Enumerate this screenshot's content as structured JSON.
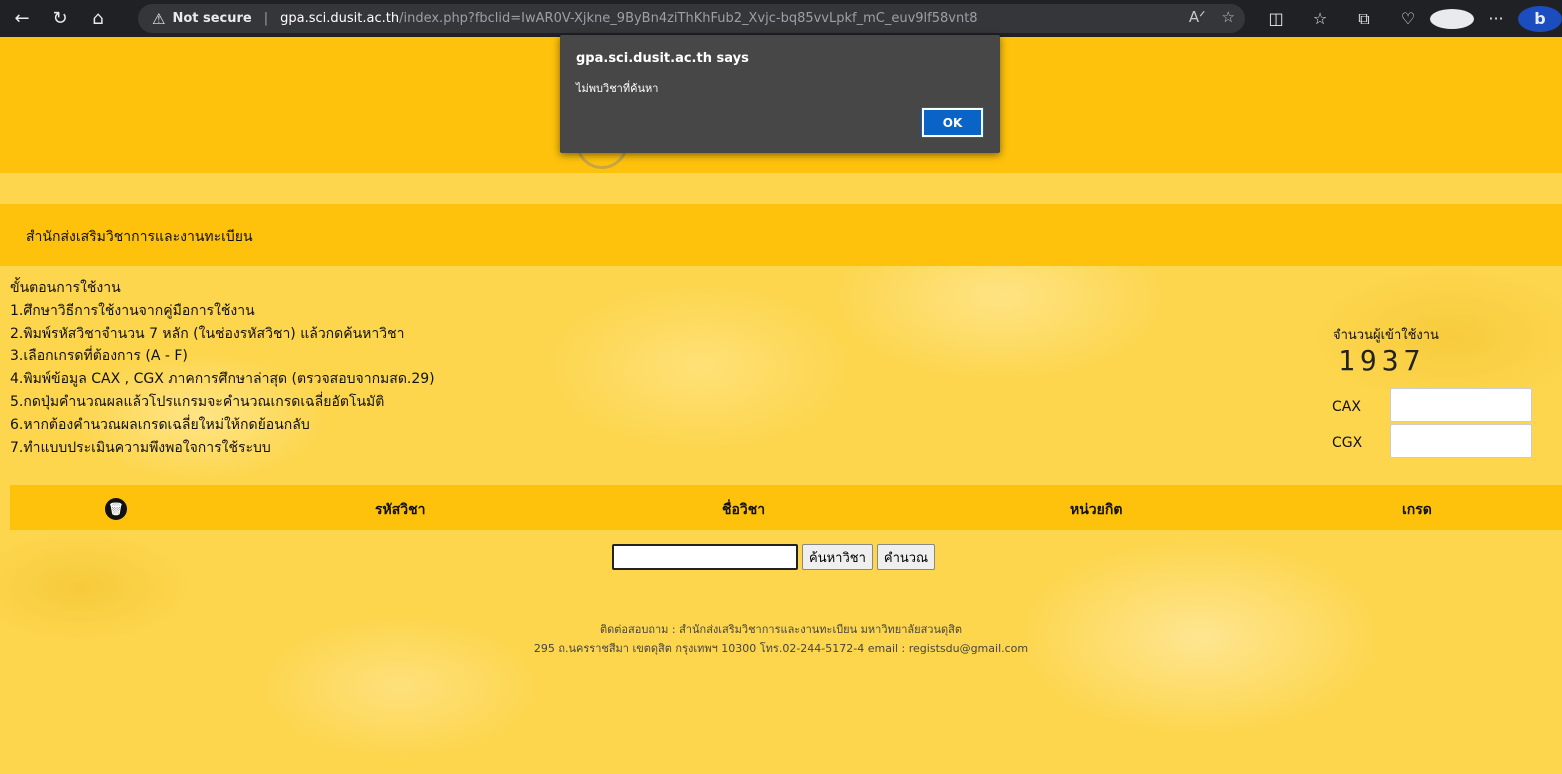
{
  "browser": {
    "security_label": "Not secure",
    "url_host": "gpa.sci.dusit.ac.th",
    "url_path": "/index.php?fbclid=IwAR0V-Xjkne_9ByBn4ziThKhFub2_Xvjc-bq85vvLpkf_mC_euv9lf58vnt8"
  },
  "header": {
    "office_name": "สำนักส่งเสริมวิชาการและงานทะเบียน"
  },
  "steps": {
    "title": "ขั้นตอนการใช้งาน",
    "items": [
      "1.ศึกษาวิธีการใช้งานจากคู่มือการใช้งาน",
      "2.พิมพ์รหัสวิชาจำนวน 7 หลัก (ในช่องรหัสวิชา) แล้วกดค้นหาวิชา",
      "3.เลือกเกรดที่ต้องการ (A - F)",
      "4.พิมพ์ข้อมูล CAX , CGX ภาคการศึกษาล่าสุด (ตรวจสอบจากมสด.29)",
      "5.กดปุ่มคำนวณผลแล้วโปรแกรมจะคำนวณเกรดเฉลี่ยอัตโนมัติ",
      "6.หากต้องคำนวณผลเกรดเฉลี่ยใหม่ให้กดย้อนกลับ",
      "7.ทำแบบประเมินความพึงพอใจการใช้ระบบ"
    ]
  },
  "visitors": {
    "label": "จำนวนผู้เข้าใช้งาน",
    "count": "1937"
  },
  "fields": {
    "cax_label": "CAX",
    "cgx_label": "CGX"
  },
  "table": {
    "headers": [
      "รหัสวิชา",
      "ชื่อวิชา",
      "หน่วยกิต",
      "เกรด"
    ]
  },
  "search": {
    "search_button": "ค้นหาวิชา",
    "calc_button": "คำนวณ"
  },
  "footer": {
    "line1": "ติดต่อสอบถาม : สำนักส่งเสริมวิชาการและงานทะเบียน มหาวิทยาลัยสวนดุสิต",
    "line2": "295 ถ.นครราชสีมา เขตดุสิต กรุงเทพฯ 10300 โทร.02-244-5172-4 email : registsdu@gmail.com"
  },
  "dialog": {
    "title": "gpa.sci.dusit.ac.th says",
    "message": "ไม่พบวิชาที่ค้นหา",
    "ok_label": "OK"
  },
  "colors": {
    "banner": "#fec20c",
    "page_background": "#fdd64e",
    "dialog_background": "#474747",
    "ok_button": "#0a64c8"
  },
  "icons": [
    "back-icon",
    "refresh-icon",
    "home-icon",
    "warning-icon",
    "trash-icon"
  ]
}
